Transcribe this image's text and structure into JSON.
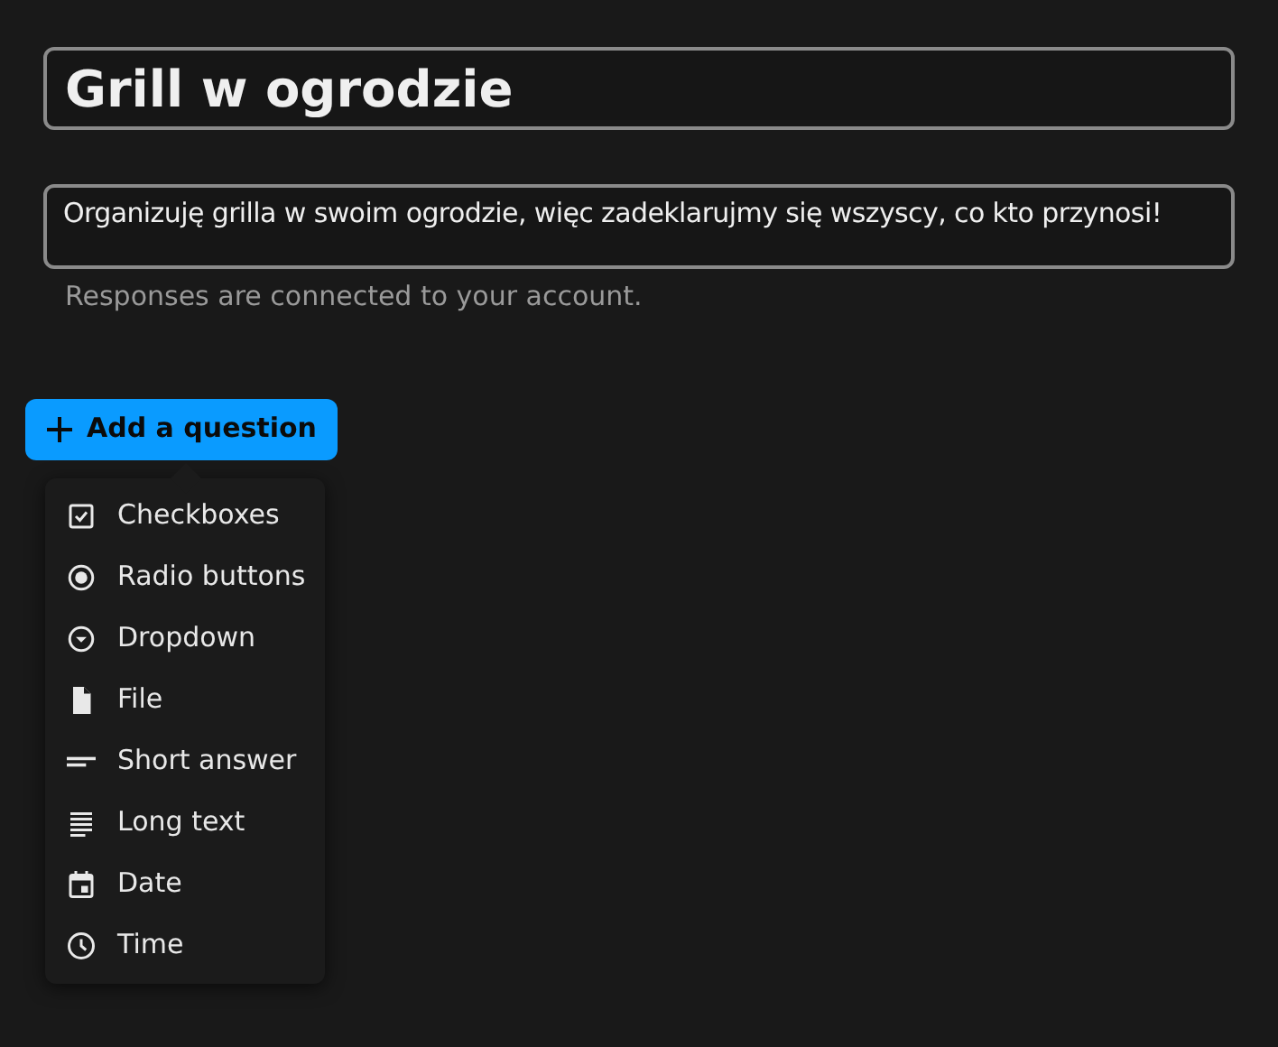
{
  "title_field": {
    "value": "Grill w ogrodzie"
  },
  "description_field": {
    "value": "Organizuję grilla w swoim ogrodzie, więc zadeklarujmy się wszyscy, co kto przynosi!"
  },
  "helper_text": "Responses are connected to your account.",
  "add_button": {
    "label": "Add a question"
  },
  "menu": [
    {
      "kind": "checkboxes",
      "label": "Checkboxes"
    },
    {
      "kind": "radio",
      "label": "Radio buttons"
    },
    {
      "kind": "dropdown",
      "label": "Dropdown"
    },
    {
      "kind": "file",
      "label": "File"
    },
    {
      "kind": "short",
      "label": "Short answer"
    },
    {
      "kind": "long",
      "label": "Long text"
    },
    {
      "kind": "date",
      "label": "Date"
    },
    {
      "kind": "time",
      "label": "Time"
    }
  ]
}
